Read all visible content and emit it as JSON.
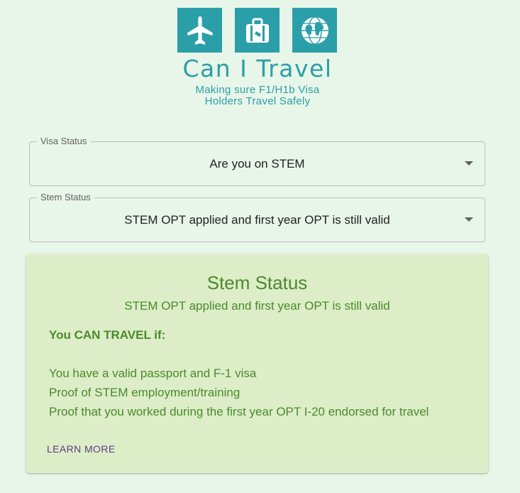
{
  "logo": {
    "title": "Can I Travel",
    "tagline_line1": "Making sure F1/H1b Visa",
    "tagline_line2": "Holders Travel Safely",
    "icons": [
      "airplane-icon",
      "suitcase-icon",
      "globe-icon"
    ],
    "color": "#2a9fa8"
  },
  "visa_select": {
    "label": "Visa Status",
    "value": "Are you on STEM"
  },
  "stem_select": {
    "label": "Stem Status",
    "value": "STEM OPT applied and first year OPT is still valid"
  },
  "card": {
    "title": "Stem Status",
    "subtitle": "STEM OPT applied and first year OPT is still valid",
    "heading": "You CAN TRAVEL if:",
    "items": [
      "You have a valid passport and F-1 visa",
      "Proof of STEM employment/training",
      "Proof that you worked during the first year OPT I-20 endorsed for travel"
    ],
    "action": "LEARN MORE",
    "background": "#dcedc8",
    "text_color": "#4b8a2a"
  }
}
